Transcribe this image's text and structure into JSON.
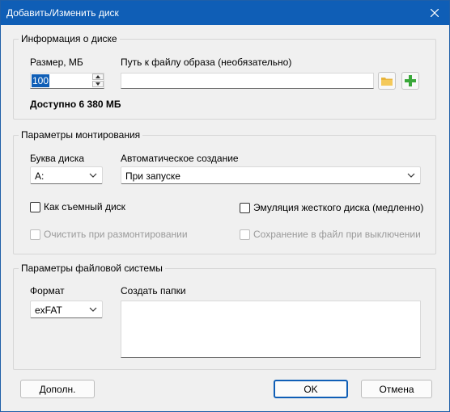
{
  "window": {
    "title": "Добавить/Изменить диск"
  },
  "disk_info": {
    "group_title": "Информация о диске",
    "size_label": "Размер, МБ",
    "size_value": "100",
    "image_path_label": "Путь к файлу образа (необязательно)",
    "image_path_value": "",
    "available_text": "Доступно 6 380 МБ"
  },
  "mount": {
    "group_title": "Параметры монтирования",
    "drive_letter_label": "Буква диска",
    "drive_letter_value": "A:",
    "auto_create_label": "Автоматическое создание",
    "auto_create_value": "При запуске",
    "removable_label": "Как съемный диск",
    "hdd_emulation_label": "Эмуляция жесткого диска (медленно)",
    "clear_on_unmount_label": "Очистить при размонтировании",
    "save_on_shutdown_label": "Сохранение в файл при выключении"
  },
  "fs": {
    "group_title": "Параметры файловой системы",
    "format_label": "Формат",
    "format_value": "exFAT",
    "create_folders_label": "Создать папки",
    "create_folders_value": ""
  },
  "buttons": {
    "more": "Дополн.",
    "ok": "OK",
    "cancel": "Отмена"
  },
  "colors": {
    "titlebar": "#0f5eb6",
    "folder_icon": "#e8b43a",
    "add_icon": "#3aa83a"
  },
  "icons": [
    "close-icon",
    "folder-icon",
    "add-icon",
    "chevron-down-icon",
    "spin-up-icon",
    "spin-down-icon"
  ]
}
